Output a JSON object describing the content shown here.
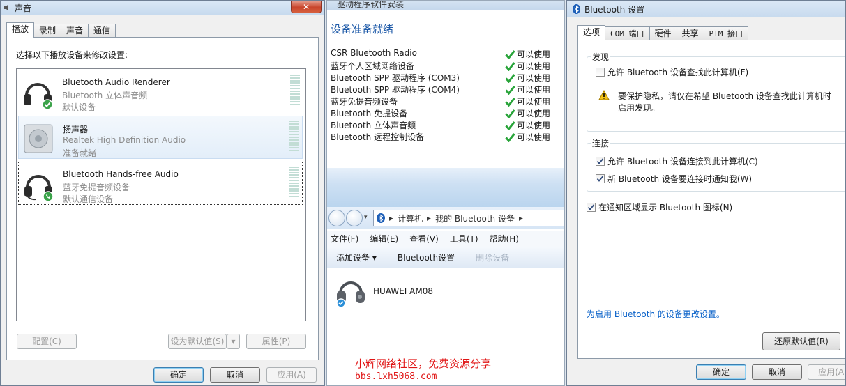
{
  "sound": {
    "title": "声音",
    "tabs": [
      "播放",
      "录制",
      "声音",
      "通信"
    ],
    "instruction": "选择以下播放设备来修改设置:",
    "devices": [
      {
        "name": "Bluetooth Audio Renderer",
        "sub": "Bluetooth 立体声音频",
        "status": "默认设备"
      },
      {
        "name": "扬声器",
        "sub": "Realtek High Definition Audio",
        "status": "准备就绪"
      },
      {
        "name": "Bluetooth Hands-free Audio",
        "sub": "蓝牙免提音频设备",
        "status": "默认通信设备"
      }
    ],
    "buttons": {
      "configure": "配置(C)",
      "set_default": "设为默认值(S)",
      "properties": "属性(P)"
    },
    "footer": {
      "ok": "确定",
      "cancel": "取消",
      "apply": "应用(A)"
    }
  },
  "driver": {
    "title": "驱动程序软件安装",
    "heading": "设备准备就绪",
    "items": [
      {
        "device": "CSR Bluetooth Radio",
        "status": "可以使用"
      },
      {
        "device": "蓝牙个人区域网络设备",
        "status": "可以使用"
      },
      {
        "device": "Bluetooth SPP 驱动程序 (COM3)",
        "status": "可以使用"
      },
      {
        "device": "Bluetooth SPP 驱动程序 (COM4)",
        "status": "可以使用"
      },
      {
        "device": "蓝牙免提音频设备",
        "status": "可以使用"
      },
      {
        "device": "Bluetooth 免提设备",
        "status": "可以使用"
      },
      {
        "device": "Bluetooth 立体声音频",
        "status": "可以使用"
      },
      {
        "device": "Bluetooth 远程控制设备",
        "status": "可以使用"
      }
    ]
  },
  "explorer": {
    "breadcrumb": [
      "计算机",
      "我的 Bluetooth 设备"
    ],
    "menu": [
      "文件(F)",
      "编辑(E)",
      "查看(V)",
      "工具(T)",
      "帮助(H)"
    ],
    "commands": {
      "add": "添加设备 ▾",
      "settings": "Bluetooth设置",
      "remove": "删除设备"
    },
    "device_name": "HUAWEI AM08"
  },
  "bt": {
    "title": "Bluetooth 设置",
    "tabs": [
      "选项",
      "COM 端口",
      "硬件",
      "共享",
      "PIM 接口"
    ],
    "discovery": {
      "title": "发现",
      "allow_find": "允许 Bluetooth 设备查找此计算机(F)",
      "warning": "要保护隐私，请仅在希望 Bluetooth 设备查找此计算机时启用发现。"
    },
    "connection": {
      "title": "连接",
      "allow_connect": "允许 Bluetooth 设备连接到此计算机(C)",
      "notify": "新 Bluetooth 设备要连接时通知我(W)"
    },
    "show_icon": "在通知区域显示 Bluetooth 图标(N)",
    "link": "为启用 Bluetooth 的设备更改设置。",
    "restore": "还原默认值(R)",
    "footer": {
      "ok": "确定",
      "cancel": "取消",
      "apply": "应用(A)"
    }
  },
  "watermark": {
    "line1": "小辉网络社区，免费资源分享",
    "line2": "bbs.lxh5068.com"
  }
}
